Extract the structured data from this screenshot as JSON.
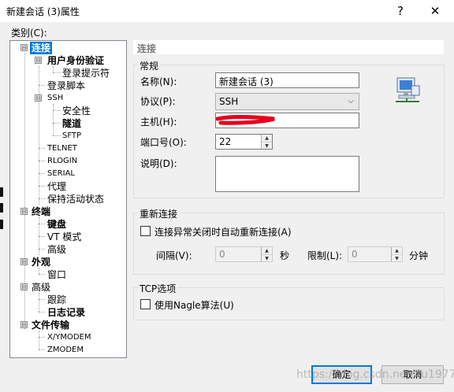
{
  "window": {
    "title": "新建会话 (3)属性",
    "help_glyph": "?",
    "close_glyph": "✕"
  },
  "category_label": "类别(C):",
  "tree": {
    "items": [
      {
        "label": "连接",
        "glyph": "⊟"
      },
      {
        "label": "用户身份验证",
        "glyph": "⊟"
      },
      {
        "label": "登录提示符"
      },
      {
        "label": "登录脚本"
      },
      {
        "label": "SSH",
        "glyph": "⊟"
      },
      {
        "label": "安全性"
      },
      {
        "label": "隧道"
      },
      {
        "label": "SFTP"
      },
      {
        "label": "TELNET"
      },
      {
        "label": "RLOGIN"
      },
      {
        "label": "SERIAL"
      },
      {
        "label": "代理"
      },
      {
        "label": "保持活动状态"
      },
      {
        "label": "终端",
        "glyph": "⊟"
      },
      {
        "label": "键盘"
      },
      {
        "label": "VT 模式"
      },
      {
        "label": "高级"
      },
      {
        "label": "外观",
        "glyph": "⊟"
      },
      {
        "label": "窗口"
      },
      {
        "label": "高级",
        "glyph": "⊟"
      },
      {
        "label": "跟踪"
      },
      {
        "label": "日志记录"
      },
      {
        "label": "文件传输",
        "glyph": "⊟"
      },
      {
        "label": "X/YMODEM"
      },
      {
        "label": "ZMODEM"
      }
    ]
  },
  "panel": {
    "header": "连接",
    "general": {
      "title": "常规",
      "name_label": "名称(N):",
      "name_value": "新建会话 (3)",
      "protocol_label": "协议(P):",
      "protocol_value": "SSH",
      "protocol_arrow": "⌵",
      "host_label": "主机(H):",
      "port_label": "端口号(O):",
      "port_value": "22",
      "desc_label": "说明(D):",
      "desc_value": ""
    },
    "reconnect": {
      "title": "重新连接",
      "checkbox_label": "连接异常关闭时自动重新连接(A)",
      "checked": false,
      "interval_label": "间隔(V):",
      "interval_value": "0",
      "interval_unit": "秒",
      "limit_label": "限制(L):",
      "limit_value": "0",
      "limit_unit": "分钟"
    },
    "tcp": {
      "title": "TCP选项",
      "nagle_label": "使用Nagle算法(U)",
      "checked": false
    }
  },
  "buttons": {
    "ok": "确定",
    "cancel": "取消"
  },
  "spin": {
    "up": "▲",
    "down": "▼"
  },
  "watermark": "https://blog.csdn.net/xu1977",
  "colors": {
    "selection": "#0078d7",
    "redaction": "#e8001c"
  }
}
